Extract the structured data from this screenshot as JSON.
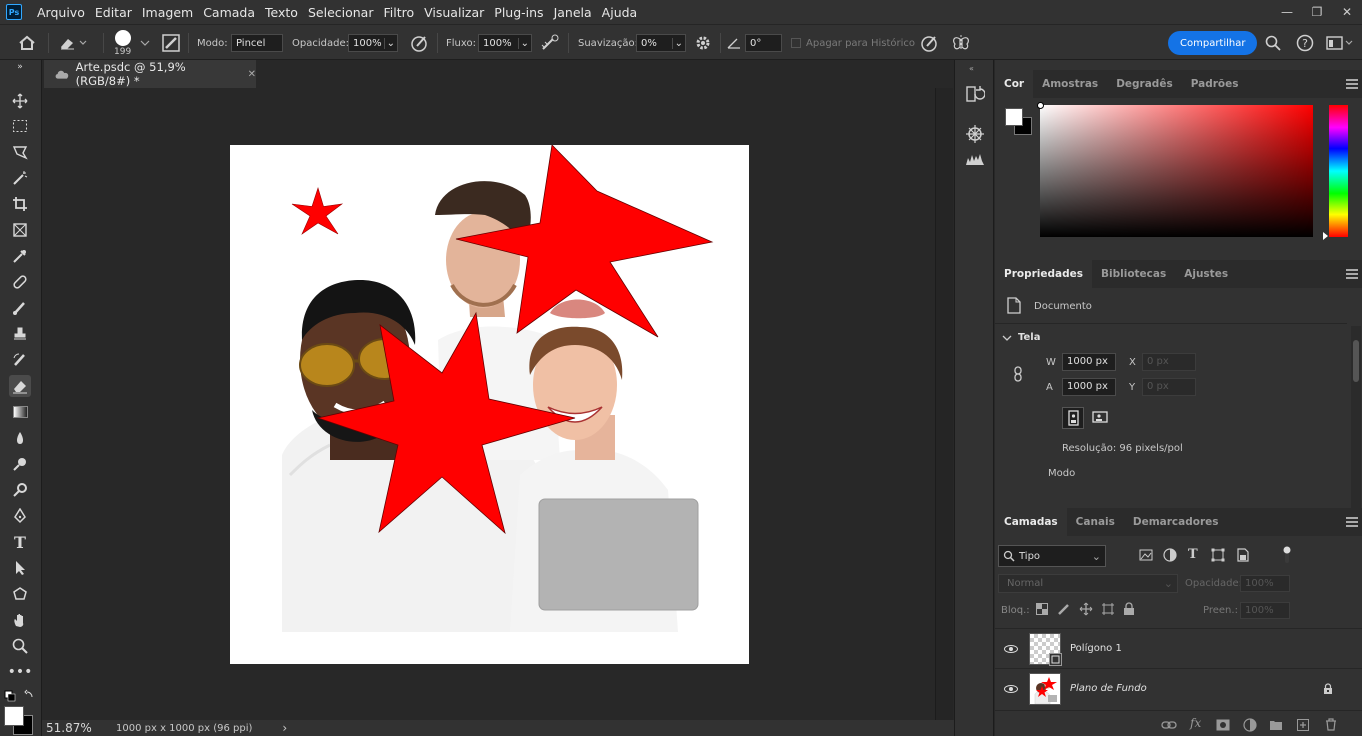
{
  "app": {
    "logo": "Ps"
  },
  "menu": [
    "Arquivo",
    "Editar",
    "Imagem",
    "Camada",
    "Texto",
    "Selecionar",
    "Filtro",
    "Visualizar",
    "Plug-ins",
    "Janela",
    "Ajuda"
  ],
  "window_controls": {
    "minimize": "—",
    "restore": "❐",
    "close": "✕"
  },
  "options": {
    "brush_size": "199",
    "mode_label": "Modo:",
    "mode_value": "Pincel",
    "opacity_label": "Opacidade:",
    "opacity_value": "100%",
    "flow_label": "Fluxo:",
    "flow_value": "100%",
    "smoothing_label": "Suavização:",
    "smoothing_value": "0%",
    "angle_value": "0°",
    "erase_history_label": "Apagar para Histórico",
    "share_label": "Compartilhar"
  },
  "document": {
    "tab_title": "Arte.psdc @ 51,9% (RGB/8#) *",
    "tab_close": "✕"
  },
  "status": {
    "zoom": "51.87%",
    "info": "1000 px x 1000 px (96 ppi)",
    "arrow": "›"
  },
  "color_panel": {
    "tabs": [
      "Cor",
      "Amostras",
      "Degradês",
      "Padrões"
    ],
    "fg_color": "#ffffff",
    "bg_color": "#000000",
    "hue_color": "#ff0000"
  },
  "properties_panel": {
    "tabs": [
      "Propriedades",
      "Bibliotecas",
      "Ajustes"
    ],
    "kind": "Documento",
    "section": "Tela",
    "w_label": "W",
    "w_value": "1000 px",
    "x_label": "X",
    "x_placeholder": "0 px",
    "h_label": "A",
    "h_value": "1000 px",
    "y_label": "Y",
    "y_placeholder": "0 px",
    "resolution": "Resolução: 96 pixels/pol",
    "mode_label": "Modo"
  },
  "layers_panel": {
    "tabs": [
      "Camadas",
      "Canais",
      "Demarcadores"
    ],
    "filter_value": "Tipo",
    "blend_mode": "Normal",
    "opacity_label": "Opacidade:",
    "opacity_value": "100%",
    "lock_label": "Bloq.:",
    "fill_label": "Preen.:",
    "fill_value": "100%",
    "layers": [
      {
        "name": "Polígono 1"
      },
      {
        "name": "Plano de Fundo"
      }
    ]
  },
  "colors": {
    "accent": "#1473e6",
    "star": "#ff0000"
  }
}
